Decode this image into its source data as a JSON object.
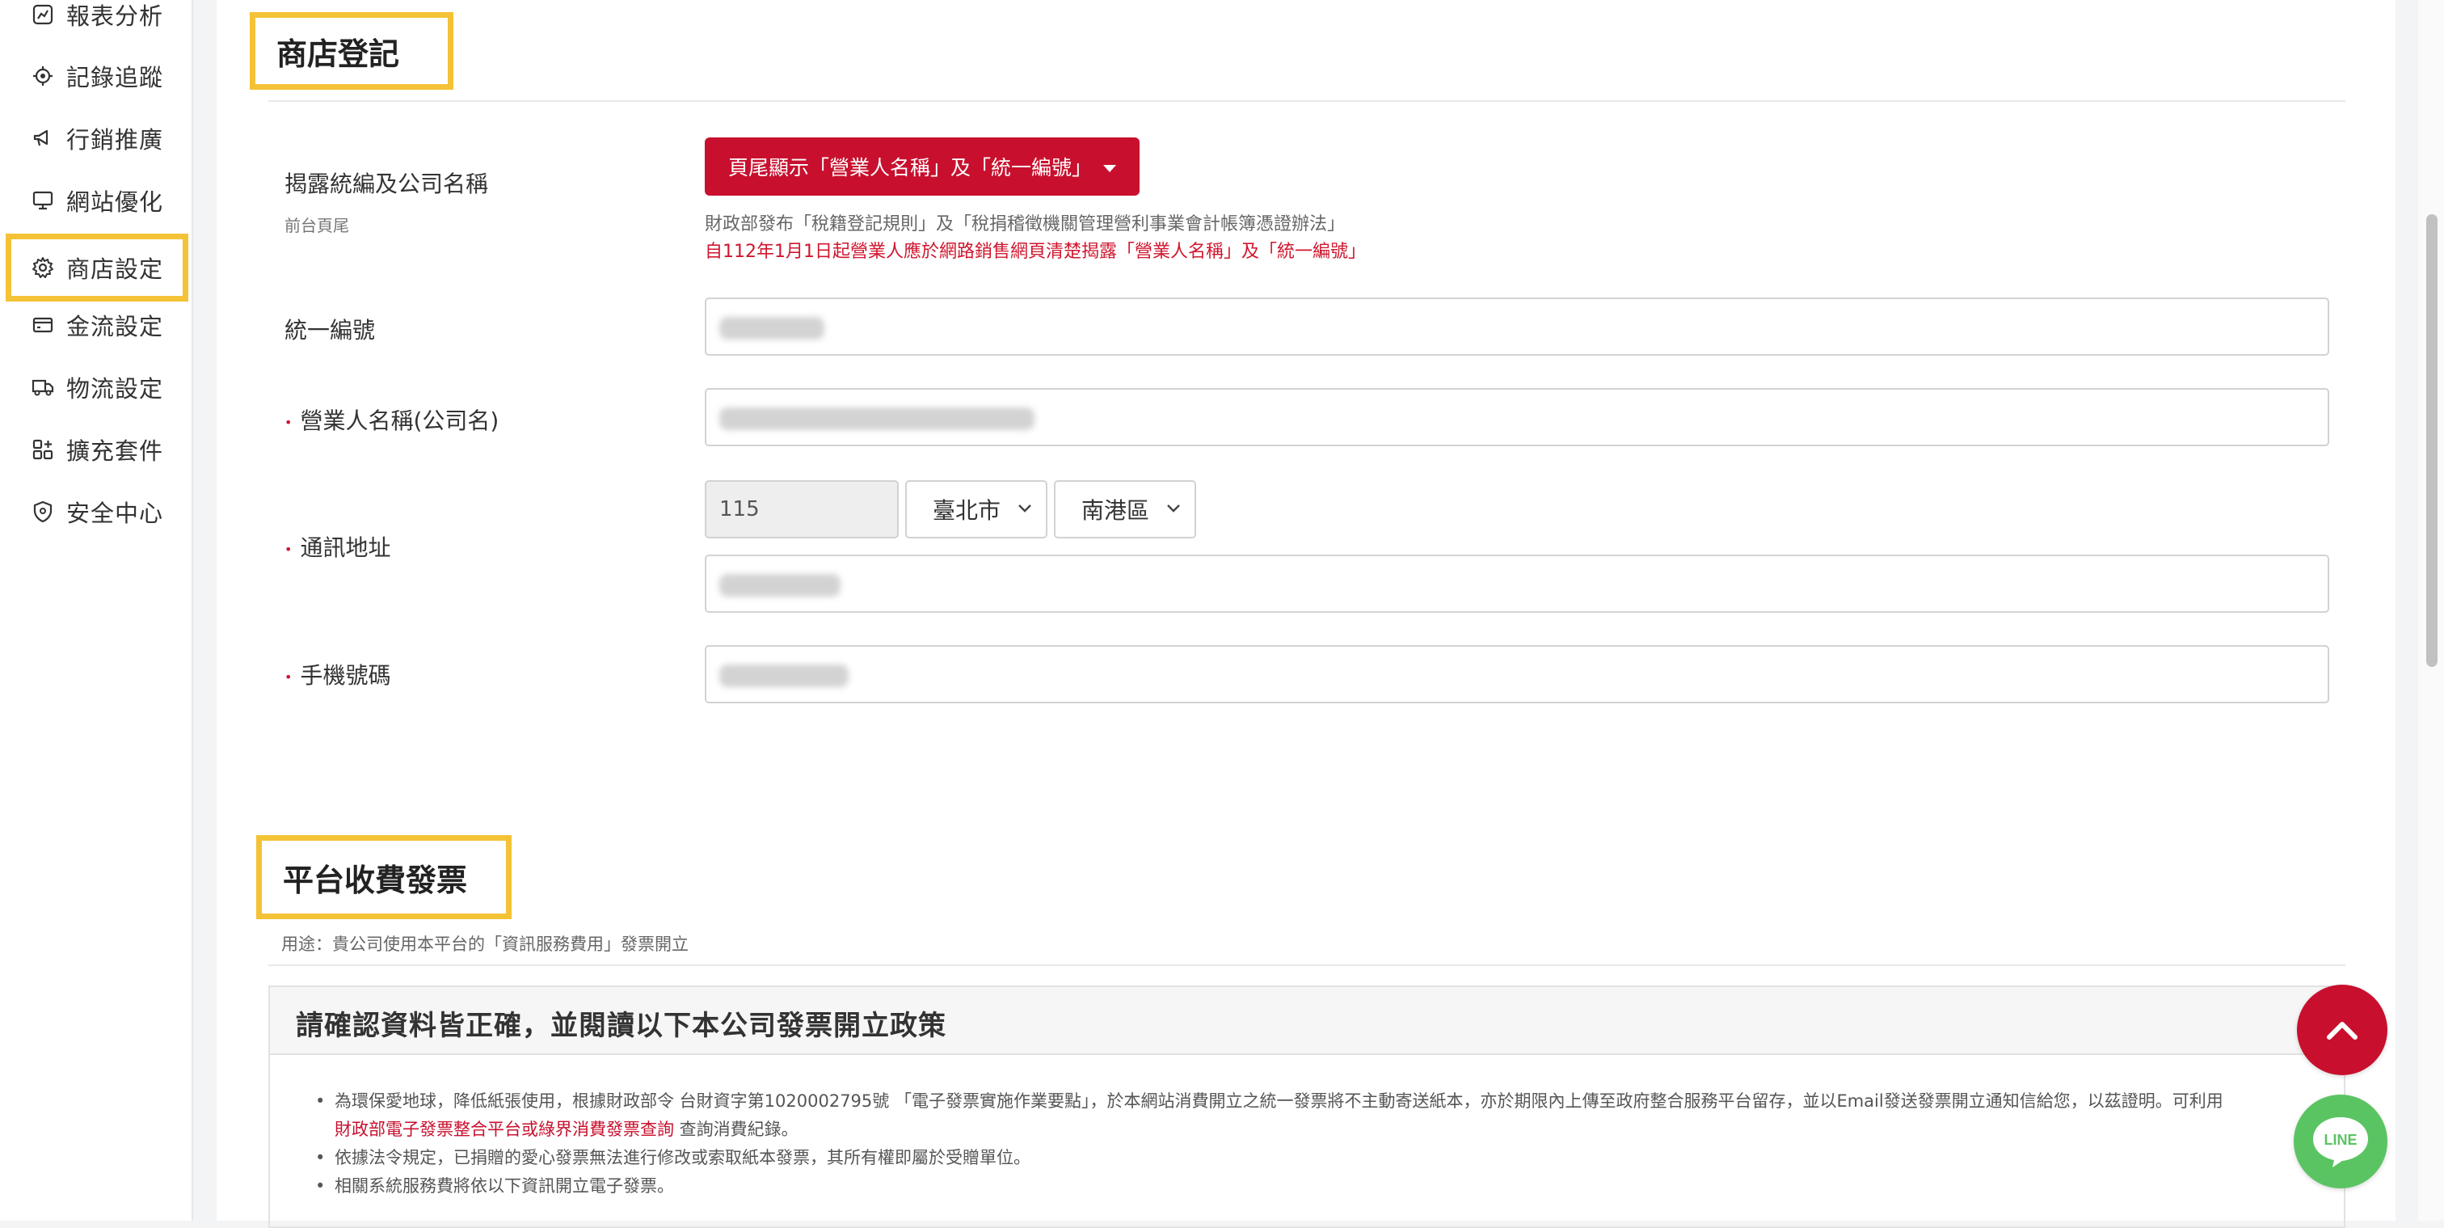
{
  "sidebar": {
    "items": [
      {
        "label": "報表分析",
        "icon": "chart-icon"
      },
      {
        "label": "記錄追蹤",
        "icon": "target-icon"
      },
      {
        "label": "行銷推廣",
        "icon": "megaphone-icon"
      },
      {
        "label": "網站優化",
        "icon": "monitor-icon"
      },
      {
        "label": "商店設定",
        "icon": "gear-icon",
        "active": true
      },
      {
        "label": "金流設定",
        "icon": "card-icon"
      },
      {
        "label": "物流設定",
        "icon": "truck-icon"
      },
      {
        "label": "擴充套件",
        "icon": "grid-plus-icon"
      },
      {
        "label": "安全中心",
        "icon": "shield-icon"
      }
    ]
  },
  "store": {
    "section_title": "商店登記",
    "disclose": {
      "label": "揭露統編及公司名稱",
      "sublabel": "前台頁尾",
      "button_label": "頁尾顯示「營業人名稱」及「統一編號」",
      "notice_line1": "財政部發布「稅籍登記規則」及「稅捐稽徵機關管理營利事業會計帳簿憑證辦法」",
      "notice_line2": "自112年1月1日起營業人應於網路銷售網頁清楚揭露「營業人名稱」及「統一編號」"
    },
    "tax_id_label": "統一編號",
    "company_label": "營業人名稱(公司名)",
    "address": {
      "label": "通訊地址",
      "zip": "115",
      "city": "臺北市",
      "district": "南港區"
    },
    "phone_label": "手機號碼"
  },
  "invoice": {
    "section_title": "平台收費發票",
    "description": "用途：貴公司使用本平台的「資訊服務費用」發票開立",
    "policy_title": "請確認資料皆正確，並閱讀以下本公司發票開立政策",
    "policy_item1": "為環保愛地球，降低紙張使用，根據財政部令 台財資字第1020002795號 「電子發票實施作業要點」，於本網站消費開立之統一發票將不主動寄送紙本，亦於期限內上傳至政府整合服務平台留存，並以Email發送發票開立通知信給您，以茲證明。可利用",
    "policy_item1_link": "財政部電子發票整合平台或綠界消費發票查詢",
    "policy_item1_tail": " 查詢消費紀錄。",
    "policy_item2": "依據法令規定，已捐贈的愛心發票無法進行修改或索取紙本發票，其所有權即屬於受贈單位。",
    "policy_item3": "相關系統服務費將依以下資訊開立電子發票。"
  },
  "floating": {
    "line_label": "LINE"
  },
  "colors": {
    "accent_red": "#c8102e",
    "highlight_yellow": "#f4c236",
    "line_green": "#5ac463"
  }
}
